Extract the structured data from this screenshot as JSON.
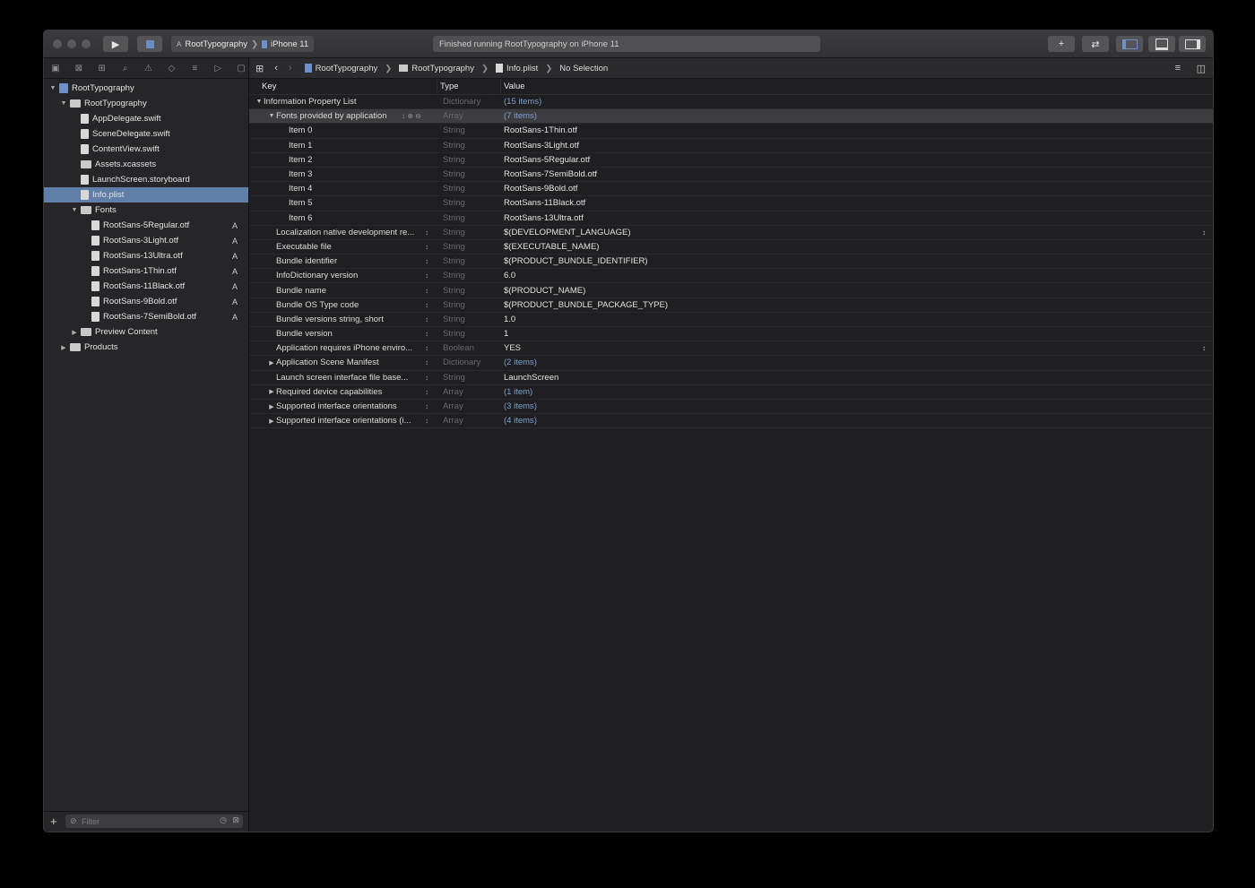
{
  "toolbar": {
    "scheme": "RootTypography",
    "device": "iPhone 11",
    "activity": "Finished running RootTypography on iPhone 11",
    "run_icon": "play-icon",
    "stop_icon": "stop-icon",
    "add_icon": "plus-icon",
    "swap_icon": "swap-arrows-icon",
    "panel_icons": [
      "navigator-panel-icon",
      "debug-panel-icon",
      "inspector-panel-icon"
    ]
  },
  "navigator": {
    "tab_icons": [
      "folder-icon",
      "source-control-icon",
      "symbol-icon",
      "search-icon",
      "warning-icon",
      "test-icon",
      "debug-icon",
      "breakpoint-icon",
      "report-icon"
    ],
    "items": [
      {
        "label": "RootTypography",
        "level": 0,
        "kind": "project",
        "open": true
      },
      {
        "label": "RootTypography",
        "level": 1,
        "kind": "folder",
        "open": true
      },
      {
        "label": "AppDelegate.swift",
        "level": 2,
        "kind": "file"
      },
      {
        "label": "SceneDelegate.swift",
        "level": 2,
        "kind": "file"
      },
      {
        "label": "ContentView.swift",
        "level": 2,
        "kind": "file"
      },
      {
        "label": "Assets.xcassets",
        "level": 2,
        "kind": "folder"
      },
      {
        "label": "LaunchScreen.storyboard",
        "level": 2,
        "kind": "file"
      },
      {
        "label": "Info.plist",
        "level": 2,
        "kind": "file",
        "selected": true
      },
      {
        "label": "Fonts",
        "level": 2,
        "kind": "folder",
        "open": true
      },
      {
        "label": "RootSans-5Regular.otf",
        "level": 3,
        "kind": "file",
        "badge": "A"
      },
      {
        "label": "RootSans-3Light.otf",
        "level": 3,
        "kind": "file",
        "badge": "A"
      },
      {
        "label": "RootSans-13Ultra.otf",
        "level": 3,
        "kind": "file",
        "badge": "A"
      },
      {
        "label": "RootSans-1Thin.otf",
        "level": 3,
        "kind": "file",
        "badge": "A"
      },
      {
        "label": "RootSans-11Black.otf",
        "level": 3,
        "kind": "file",
        "badge": "A"
      },
      {
        "label": "RootSans-9Bold.otf",
        "level": 3,
        "kind": "file",
        "badge": "A"
      },
      {
        "label": "RootSans-7SemiBold.otf",
        "level": 3,
        "kind": "file",
        "badge": "A"
      },
      {
        "label": "Preview Content",
        "level": 2,
        "kind": "folder",
        "open": false
      },
      {
        "label": "Products",
        "level": 1,
        "kind": "folder",
        "open": false
      }
    ],
    "filter_placeholder": "Filter"
  },
  "jumpbar": {
    "crumbs": [
      "RootTypography",
      "RootTypography",
      "Info.plist",
      "No Selection"
    ]
  },
  "plist": {
    "headers": {
      "key": "Key",
      "type": "Type",
      "value": "Value"
    },
    "rows": [
      {
        "key": "Information Property List",
        "type": "Dictionary",
        "value": "(15 items)",
        "indent": 0,
        "disc": "open",
        "count": true
      },
      {
        "key": "Fonts provided by application",
        "type": "Array",
        "value": "(7 items)",
        "indent": 1,
        "disc": "open",
        "count": true,
        "highlight": true
      },
      {
        "key": "Item 0",
        "type": "String",
        "value": "RootSans-1Thin.otf",
        "indent": 2
      },
      {
        "key": "Item 1",
        "type": "String",
        "value": "RootSans-3Light.otf",
        "indent": 2
      },
      {
        "key": "Item 2",
        "type": "String",
        "value": "RootSans-5Regular.otf",
        "indent": 2
      },
      {
        "key": "Item 3",
        "type": "String",
        "value": "RootSans-7SemiBold.otf",
        "indent": 2
      },
      {
        "key": "Item 4",
        "type": "String",
        "value": "RootSans-9Bold.otf",
        "indent": 2
      },
      {
        "key": "Item 5",
        "type": "String",
        "value": "RootSans-11Black.otf",
        "indent": 2
      },
      {
        "key": "Item 6",
        "type": "String",
        "value": "RootSans-13Ultra.otf",
        "indent": 2
      },
      {
        "key": "Localization native development re...",
        "type": "String",
        "value": "$(DEVELOPMENT_LANGUAGE)",
        "indent": 1,
        "stepper": true,
        "rstep": true
      },
      {
        "key": "Executable file",
        "type": "String",
        "value": "$(EXECUTABLE_NAME)",
        "indent": 1,
        "stepper": true
      },
      {
        "key": "Bundle identifier",
        "type": "String",
        "value": "$(PRODUCT_BUNDLE_IDENTIFIER)",
        "indent": 1,
        "stepper": true
      },
      {
        "key": "InfoDictionary version",
        "type": "String",
        "value": "6.0",
        "indent": 1,
        "stepper": true
      },
      {
        "key": "Bundle name",
        "type": "String",
        "value": "$(PRODUCT_NAME)",
        "indent": 1,
        "stepper": true
      },
      {
        "key": "Bundle OS Type code",
        "type": "String",
        "value": "$(PRODUCT_BUNDLE_PACKAGE_TYPE)",
        "indent": 1,
        "stepper": true
      },
      {
        "key": "Bundle versions string, short",
        "type": "String",
        "value": "1.0",
        "indent": 1,
        "stepper": true
      },
      {
        "key": "Bundle version",
        "type": "String",
        "value": "1",
        "indent": 1,
        "stepper": true
      },
      {
        "key": "Application requires iPhone enviro...",
        "type": "Boolean",
        "value": "YES",
        "indent": 1,
        "stepper": true,
        "rstep": true
      },
      {
        "key": "Application Scene Manifest",
        "type": "Dictionary",
        "value": "(2 items)",
        "indent": 1,
        "disc": "closed",
        "stepper": true,
        "count": true
      },
      {
        "key": "Launch screen interface file base...",
        "type": "String",
        "value": "LaunchScreen",
        "indent": 1,
        "stepper": true
      },
      {
        "key": "Required device capabilities",
        "type": "Array",
        "value": "(1 item)",
        "indent": 1,
        "disc": "closed",
        "stepper": true,
        "count": true
      },
      {
        "key": "Supported interface orientations",
        "type": "Array",
        "value": "(3 items)",
        "indent": 1,
        "disc": "closed",
        "stepper": true,
        "count": true
      },
      {
        "key": "Supported interface orientations (i...",
        "type": "Array",
        "value": "(4 items)",
        "indent": 1,
        "disc": "closed",
        "stepper": true,
        "count": true
      }
    ]
  }
}
